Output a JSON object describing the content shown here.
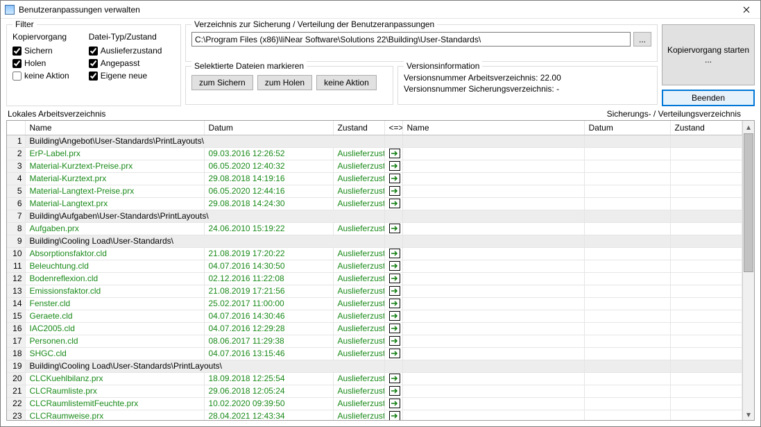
{
  "window": {
    "title": "Benutzeranpassungen verwalten"
  },
  "filter": {
    "legend": "Filter",
    "col1_header": "Kopiervorgang",
    "col2_header": "Datei-Typ/Zustand",
    "sichern": "Sichern",
    "holen": "Holen",
    "keine": "keine Aktion",
    "auslief": "Auslieferzustand",
    "angepasst": "Angepasst",
    "eigene": "Eigene neue",
    "sichern_checked": true,
    "holen_checked": true,
    "keine_checked": false,
    "auslief_checked": true,
    "angepasst_checked": true,
    "eigene_checked": true
  },
  "path": {
    "legend": "Verzeichnis zur Sicherung / Verteilung der Benutzeranpassungen",
    "value": "C:\\Program Files (x86)\\liNear Software\\Solutions 22\\Building\\User-Standards\\",
    "browse": "..."
  },
  "mark": {
    "legend": "Selektierte Dateien markieren",
    "zum_sichern": "zum Sichern",
    "zum_holen": "zum Holen",
    "keine_aktion": "keine Aktion"
  },
  "version": {
    "legend": "Versionsinformation",
    "line1": "Versionsnummer Arbeitsverzeichnis: 22.00",
    "line2": "Versionsnummer Sicherungsverzeichnis: -"
  },
  "buttons": {
    "start": "Kopiervorgang starten ...",
    "end": "Beenden"
  },
  "dirlabels": {
    "left": "Lokales Arbeitsverzeichnis",
    "right": "Sicherungs- / Verteilungsverzeichnis"
  },
  "columns": {
    "name": "Name",
    "datum": "Datum",
    "zustand": "Zustand",
    "arrow": "<=>"
  },
  "rows": [
    {
      "n": 1,
      "type": "group",
      "name": "Building\\Angebot\\User-Standards\\PrintLayouts\\"
    },
    {
      "n": 2,
      "type": "file",
      "name": "ErP-Label.prx",
      "date": "09.03.2016 12:26:52",
      "state": "Auslieferzustand"
    },
    {
      "n": 3,
      "type": "file",
      "name": "Material-Kurztext-Preise.prx",
      "date": "06.05.2020 12:40:32",
      "state": "Auslieferzustand"
    },
    {
      "n": 4,
      "type": "file",
      "name": "Material-Kurztext.prx",
      "date": "29.08.2018 14:19:16",
      "state": "Auslieferzustand"
    },
    {
      "n": 5,
      "type": "file",
      "name": "Material-Langtext-Preise.prx",
      "date": "06.05.2020 12:44:16",
      "state": "Auslieferzustand"
    },
    {
      "n": 6,
      "type": "file",
      "name": "Material-Langtext.prx",
      "date": "29.08.2018 14:24:30",
      "state": "Auslieferzustand"
    },
    {
      "n": 7,
      "type": "group",
      "name": "Building\\Aufgaben\\User-Standards\\PrintLayouts\\"
    },
    {
      "n": 8,
      "type": "file",
      "name": "Aufgaben.prx",
      "date": "24.06.2010 15:19:22",
      "state": "Auslieferzustand"
    },
    {
      "n": 9,
      "type": "group",
      "name": "Building\\Cooling Load\\User-Standards\\"
    },
    {
      "n": 10,
      "type": "file",
      "name": "Absorptionsfaktor.cld",
      "date": "21.08.2019 17:20:22",
      "state": "Auslieferzustand"
    },
    {
      "n": 11,
      "type": "file",
      "name": "Beleuchtung.cld",
      "date": "04.07.2016 14:30:50",
      "state": "Auslieferzustand"
    },
    {
      "n": 12,
      "type": "file",
      "name": "Bodenreflexion.cld",
      "date": "02.12.2016 11:22:08",
      "state": "Auslieferzustand"
    },
    {
      "n": 13,
      "type": "file",
      "name": "Emissionsfaktor.cld",
      "date": "21.08.2019 17:21:56",
      "state": "Auslieferzustand"
    },
    {
      "n": 14,
      "type": "file",
      "name": "Fenster.cld",
      "date": "25.02.2017 11:00:00",
      "state": "Auslieferzustand"
    },
    {
      "n": 15,
      "type": "file",
      "name": "Geraete.cld",
      "date": "04.07.2016 14:30:46",
      "state": "Auslieferzustand"
    },
    {
      "n": 16,
      "type": "file",
      "name": "IAC2005.cld",
      "date": "04.07.2016 12:29:28",
      "state": "Auslieferzustand"
    },
    {
      "n": 17,
      "type": "file",
      "name": "Personen.cld",
      "date": "08.06.2017 11:29:38",
      "state": "Auslieferzustand"
    },
    {
      "n": 18,
      "type": "file",
      "name": "SHGC.cld",
      "date": "04.07.2016 13:15:46",
      "state": "Auslieferzustand"
    },
    {
      "n": 19,
      "type": "group",
      "name": "Building\\Cooling Load\\User-Standards\\PrintLayouts\\"
    },
    {
      "n": 20,
      "type": "file",
      "name": "CLCKuehlbilanz.prx",
      "date": "18.09.2018 12:25:54",
      "state": "Auslieferzustand"
    },
    {
      "n": 21,
      "type": "file",
      "name": "CLCRaumliste.prx",
      "date": "29.06.2018 12:05:24",
      "state": "Auslieferzustand"
    },
    {
      "n": 22,
      "type": "file",
      "name": "CLCRaumlistemitFeuchte.prx",
      "date": "10.02.2020 09:39:50",
      "state": "Auslieferzustand"
    },
    {
      "n": 23,
      "type": "file",
      "name": "CLCRaumweise.prx",
      "date": "28.04.2021 12:43:34",
      "state": "Auslieferzustand"
    }
  ]
}
